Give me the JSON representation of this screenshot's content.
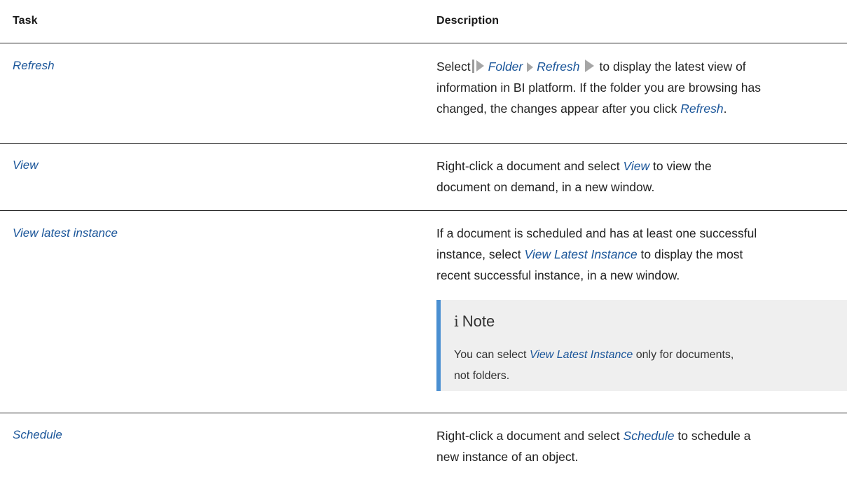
{
  "header": {
    "task": "Task",
    "description": "Description"
  },
  "rows": [
    {
      "task": "Refresh",
      "desc": {
        "l1_a": "Select",
        "path_1": "Folder",
        "path_2": "Refresh",
        "l1_b": "to display the latest view of",
        "l2": "information in BI platform. If the folder you are browsing has",
        "l3_a": "changed, the changes appear after you click ",
        "l3_ui": "Refresh",
        "l3_b": "."
      }
    },
    {
      "task": "View",
      "desc": {
        "l1_a": "Right-click a document and select ",
        "l1_ui": "View",
        "l1_b": " to view the",
        "l2": "document on demand, in a new window."
      }
    },
    {
      "task": "View latest instance",
      "desc": {
        "l1": "If a document is scheduled and has at least one successful",
        "l2_a": "instance, select ",
        "l2_ui": "View Latest Instance",
        "l2_b": " to display the most",
        "l3": "recent successful instance, in a new window."
      },
      "note": {
        "icon": "i",
        "title": "Note",
        "l1_a": "You can select ",
        "l1_ui": "View Latest Instance",
        "l1_b": " only for documents,",
        "l2": "not folders."
      }
    },
    {
      "task": "Schedule",
      "desc": {
        "l1_a": "Right-click a document and select ",
        "l1_ui": "Schedule",
        "l1_b": " to schedule a",
        "l2": "new instance of an object."
      }
    }
  ],
  "colors": {
    "link": "#1a5599",
    "note_accent": "#4a8fd1",
    "note_bg": "#efefef"
  }
}
